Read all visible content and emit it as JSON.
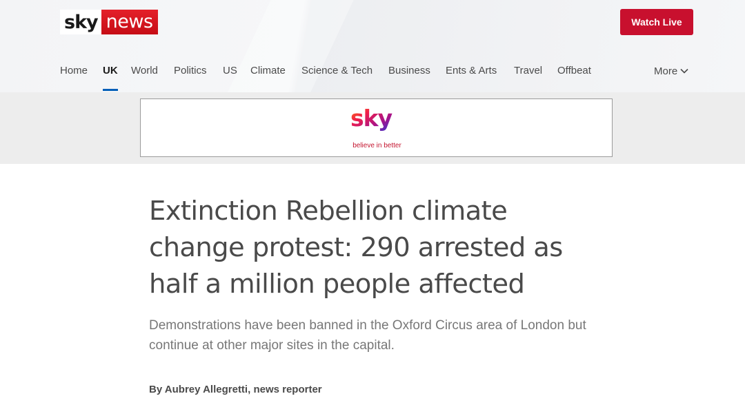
{
  "header": {
    "logo_sky": "sky",
    "logo_news": "news",
    "watch_live_label": "Watch Live"
  },
  "nav": {
    "items": [
      {
        "label": "Home",
        "active": false
      },
      {
        "label": "UK",
        "active": true
      },
      {
        "label": "World",
        "active": false
      },
      {
        "label": "Politics",
        "active": false
      },
      {
        "label": "US",
        "active": false
      },
      {
        "label": "Climate",
        "active": false
      },
      {
        "label": "Science & Tech",
        "active": false
      },
      {
        "label": "Business",
        "active": false
      },
      {
        "label": "Ents & Arts",
        "active": false
      },
      {
        "label": "Travel",
        "active": false
      },
      {
        "label": "Offbeat",
        "active": false
      }
    ],
    "more_label": "More",
    "more_icon": "chevron-down-icon"
  },
  "advert": {
    "logo_text": "sky",
    "tagline": "believe in better"
  },
  "article": {
    "headline_lines": [
      "Extinction Rebellion climate",
      "change protest: 290 arrested as",
      "half a million people affected"
    ],
    "standfirst": "Demonstrations have been banned in the Oxford Circus area of London but continue at other major sites in the capital.",
    "byline_prefix": "By ",
    "byline_author": "Aubrey Allegretti",
    "byline_role": ", news reporter"
  },
  "colors": {
    "brand_red": "#c8102e",
    "active_underline": "#005eb8",
    "text_primary": "#4a4a4a",
    "text_secondary": "#777777"
  }
}
